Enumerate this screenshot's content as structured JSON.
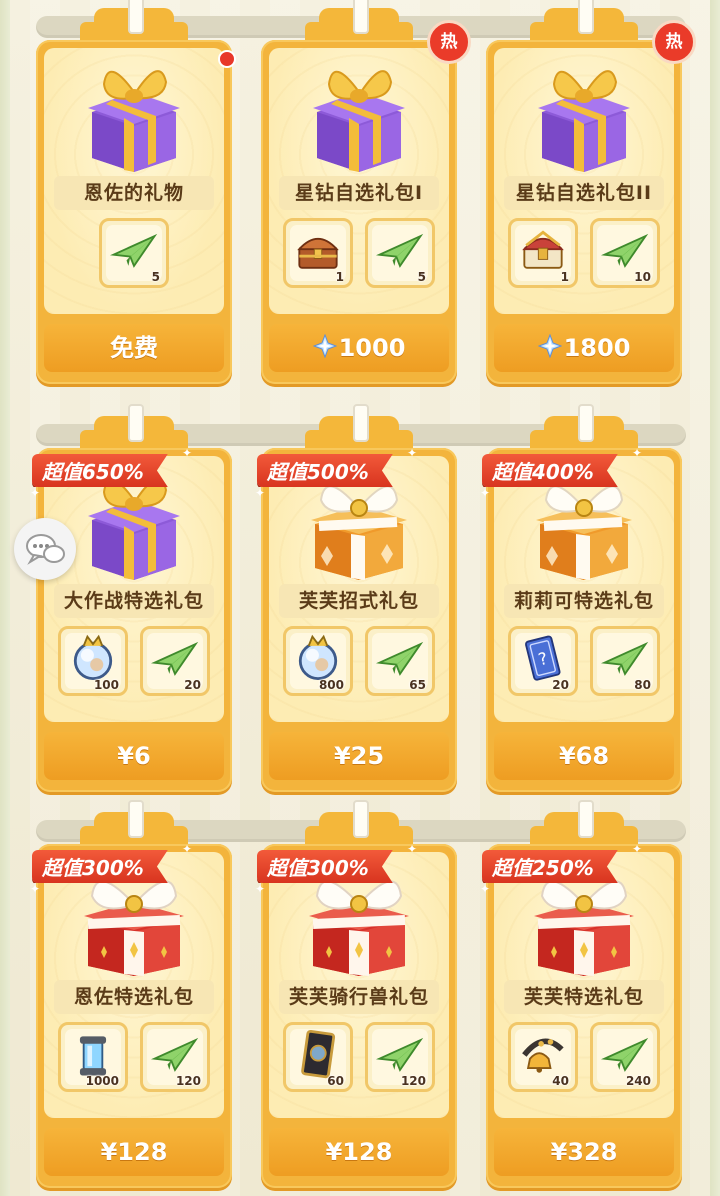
{
  "colors": {
    "card_orange": "#f3b43c",
    "price_text": "#ffffff",
    "badge_red": "#e5432b",
    "title_text": "#5a3b18"
  },
  "rows": [
    {
      "cards": [
        {
          "title": "恩佐的礼物",
          "gift": "purple",
          "price": "免费",
          "price_icon": "",
          "marker": "dot",
          "items": [
            {
              "icon": "paper-plane-icon",
              "qty": "5"
            }
          ]
        },
        {
          "title": "星钻自选礼包I",
          "gift": "purple",
          "price": "1000",
          "price_icon": "star-diamond-icon",
          "marker": "热",
          "items": [
            {
              "icon": "treasure-chest-icon",
              "qty": "1"
            },
            {
              "icon": "paper-plane-icon",
              "qty": "5"
            }
          ]
        },
        {
          "title": "星钻自选礼包II",
          "gift": "purple",
          "price": "1800",
          "price_icon": "star-diamond-icon",
          "marker": "热",
          "items": [
            {
              "icon": "ornate-chest-icon",
              "qty": "1"
            },
            {
              "icon": "paper-plane-icon",
              "qty": "10"
            }
          ]
        }
      ]
    },
    {
      "cards": [
        {
          "title": "大作战特选礼包",
          "gift": "purple",
          "price": "¥6",
          "badge": "超值650%",
          "items": [
            {
              "icon": "crystal-orb-icon",
              "qty": "100"
            },
            {
              "icon": "paper-plane-icon",
              "qty": "20"
            }
          ]
        },
        {
          "title": "芙芙招式礼包",
          "gift": "orange",
          "price": "¥25",
          "badge": "超值500%",
          "items": [
            {
              "icon": "crystal-orb-icon",
              "qty": "800"
            },
            {
              "icon": "paper-plane-icon",
              "qty": "65"
            }
          ]
        },
        {
          "title": "莉莉可特选礼包",
          "gift": "orange",
          "price": "¥68",
          "badge": "超值400%",
          "items": [
            {
              "icon": "skill-card-icon",
              "qty": "20"
            },
            {
              "icon": "paper-plane-icon",
              "qty": "80"
            }
          ]
        }
      ]
    },
    {
      "cards": [
        {
          "title": "恩佐特选礼包",
          "gift": "red",
          "price": "¥128",
          "badge": "超值300%",
          "items": [
            {
              "icon": "energy-capsule-icon",
              "qty": "1000"
            },
            {
              "icon": "paper-plane-icon",
              "qty": "120"
            }
          ]
        },
        {
          "title": "芙芙骑行兽礼包",
          "gift": "red",
          "price": "¥128",
          "badge": "超值300%",
          "items": [
            {
              "icon": "mount-card-icon",
              "qty": "60"
            },
            {
              "icon": "paper-plane-icon",
              "qty": "120"
            }
          ]
        },
        {
          "title": "芙芙特选礼包",
          "gift": "red",
          "price": "¥328",
          "badge": "超值250%",
          "items": [
            {
              "icon": "bell-headband-icon",
              "qty": "40"
            },
            {
              "icon": "paper-plane-icon",
              "qty": "240"
            }
          ]
        }
      ]
    }
  ]
}
